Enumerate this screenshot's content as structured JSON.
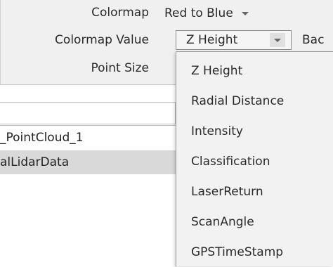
{
  "properties": {
    "colormap_label": "Colormap",
    "colormap_value": "Red to Blue",
    "colormap_value_label": "Colormap Value",
    "colormap_value_selected": "Z Height",
    "point_size_label": "Point Size",
    "truncated_right_label": "Bac"
  },
  "tree": {
    "items": [
      {
        "label": "_PointCloud_1"
      },
      {
        "label": "alLidarData"
      }
    ]
  },
  "colormap_value_options": [
    "Z Height",
    "Radial Distance",
    "Intensity",
    "Classification",
    "LaserReturn",
    "ScanAngle",
    "GPSTimeStamp"
  ]
}
